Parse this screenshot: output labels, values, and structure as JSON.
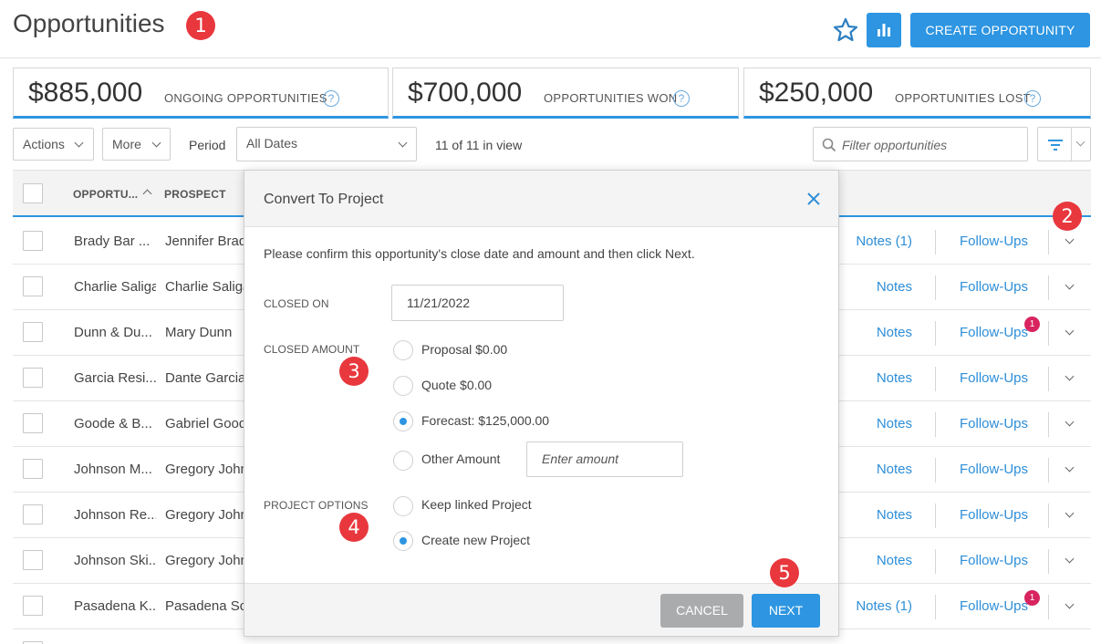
{
  "header": {
    "title": "Opportunities",
    "create_label": "CREATE OPPORTUNITY",
    "accent_color": "#2d95e1"
  },
  "markers": [
    "1",
    "2",
    "3",
    "4",
    "5"
  ],
  "stats": [
    {
      "amount": "$885,000",
      "label": "ONGOING OPPORTUNITIES",
      "help": "?"
    },
    {
      "amount": "$700,000",
      "label": "OPPORTUNITIES WON",
      "help": "?"
    },
    {
      "amount": "$250,000",
      "label": "OPPORTUNITIES LOST",
      "help": "?"
    }
  ],
  "toolbar": {
    "actions_label": "Actions",
    "more_label": "More",
    "period_label": "Period",
    "period_value": "All Dates",
    "in_view": "11 of 11 in view",
    "filter_placeholder": "Filter opportunities"
  },
  "table": {
    "columns": [
      "OPPORTU...",
      "PROSPECT"
    ],
    "rows": [
      {
        "opportunity": "Brady Bar ...",
        "prospect": "Jennifer Brady",
        "notes": "Notes (1)",
        "followups": "Follow-Ups",
        "badge": ""
      },
      {
        "opportunity": "Charlie Saliga",
        "prospect": "Charlie Saliga",
        "notes": "Notes",
        "followups": "Follow-Ups",
        "badge": ""
      },
      {
        "opportunity": "Dunn & Du...",
        "prospect": "Mary Dunn",
        "notes": "Notes",
        "followups": "Follow-Ups",
        "badge": "1"
      },
      {
        "opportunity": "Garcia Resi...",
        "prospect": "Dante Garcia",
        "notes": "Notes",
        "followups": "Follow-Ups",
        "badge": ""
      },
      {
        "opportunity": "Goode & B...",
        "prospect": "Gabriel Goode",
        "notes": "Notes",
        "followups": "Follow-Ups",
        "badge": ""
      },
      {
        "opportunity": "Johnson M...",
        "prospect": "Gregory Johnson",
        "notes": "Notes",
        "followups": "Follow-Ups",
        "badge": ""
      },
      {
        "opportunity": "Johnson Re...",
        "prospect": "Gregory Johnson",
        "notes": "Notes",
        "followups": "Follow-Ups",
        "badge": ""
      },
      {
        "opportunity": "Johnson Ski...",
        "prospect": "Gregory Johnson",
        "notes": "Notes",
        "followups": "Follow-Ups",
        "badge": ""
      },
      {
        "opportunity": "Pasadena K...",
        "prospect": "Pasadena School",
        "notes": "Notes (1)",
        "followups": "Follow-Ups",
        "badge": "1"
      }
    ]
  },
  "modal": {
    "title": "Convert To Project",
    "description": "Please confirm this opportunity's close date and amount and then click Next.",
    "closed_on_label": "CLOSED ON",
    "closed_on_value": "11/21/2022",
    "closed_amount_label": "CLOSED AMOUNT",
    "amount_options": [
      {
        "label": "Proposal $0.00",
        "selected": false
      },
      {
        "label": "Quote $0.00",
        "selected": false
      },
      {
        "label": "Forecast: $125,000.00",
        "selected": true
      },
      {
        "label": "Other Amount",
        "selected": false
      }
    ],
    "other_amount_placeholder": "Enter amount",
    "project_options_label": "PROJECT OPTIONS",
    "project_options": [
      {
        "label": "Keep linked Project",
        "selected": false
      },
      {
        "label": "Create new Project",
        "selected": true
      }
    ],
    "cancel_label": "CANCEL",
    "next_label": "NEXT"
  }
}
